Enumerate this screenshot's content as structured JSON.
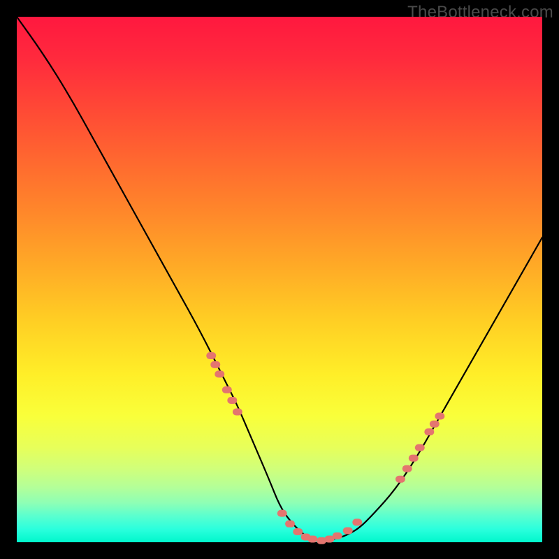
{
  "watermark": "TheBottleneck.com",
  "colors": {
    "page_bg": "#000000",
    "curve_stroke": "#000000",
    "marker_fill": "#e4756f",
    "watermark_text": "#4a4a4a"
  },
  "chart_data": {
    "type": "line",
    "title": "",
    "xlabel": "",
    "ylabel": "",
    "xlim": [
      0,
      100
    ],
    "ylim": [
      0,
      100
    ],
    "grid": false,
    "legend": false,
    "curve": {
      "x": [
        0,
        5,
        10,
        15,
        20,
        25,
        30,
        35,
        40,
        42,
        45,
        48,
        50,
        52,
        55,
        58,
        60,
        62,
        65,
        68,
        72,
        76,
        80,
        84,
        88,
        92,
        96,
        100
      ],
      "y": [
        100,
        93,
        85,
        76,
        67,
        58,
        49,
        40,
        30,
        26,
        19,
        12,
        7,
        4,
        1,
        0.2,
        0.5,
        1.0,
        2.5,
        5.5,
        10,
        16,
        23,
        30,
        37,
        44,
        51,
        58
      ]
    },
    "marker_clusters": [
      {
        "name": "left-arm-markers",
        "points": [
          {
            "x": 37.0,
            "y": 35.5
          },
          {
            "x": 37.8,
            "y": 33.8
          },
          {
            "x": 38.6,
            "y": 32.0
          },
          {
            "x": 40.0,
            "y": 29.0
          },
          {
            "x": 41.0,
            "y": 27.0
          },
          {
            "x": 42.0,
            "y": 24.8
          }
        ]
      },
      {
        "name": "valley-markers",
        "points": [
          {
            "x": 50.5,
            "y": 5.5
          },
          {
            "x": 52.0,
            "y": 3.5
          },
          {
            "x": 53.5,
            "y": 2.0
          },
          {
            "x": 55.0,
            "y": 1.0
          },
          {
            "x": 56.3,
            "y": 0.6
          },
          {
            "x": 58.0,
            "y": 0.3
          },
          {
            "x": 59.5,
            "y": 0.6
          },
          {
            "x": 61.0,
            "y": 1.2
          },
          {
            "x": 63.0,
            "y": 2.2
          },
          {
            "x": 64.8,
            "y": 3.8
          }
        ]
      },
      {
        "name": "right-arm-markers",
        "points": [
          {
            "x": 73.0,
            "y": 12.0
          },
          {
            "x": 74.3,
            "y": 14.0
          },
          {
            "x": 75.5,
            "y": 16.0
          },
          {
            "x": 76.7,
            "y": 18.0
          },
          {
            "x": 78.5,
            "y": 21.0
          },
          {
            "x": 79.5,
            "y": 22.5
          },
          {
            "x": 80.5,
            "y": 24.0
          }
        ]
      }
    ]
  }
}
